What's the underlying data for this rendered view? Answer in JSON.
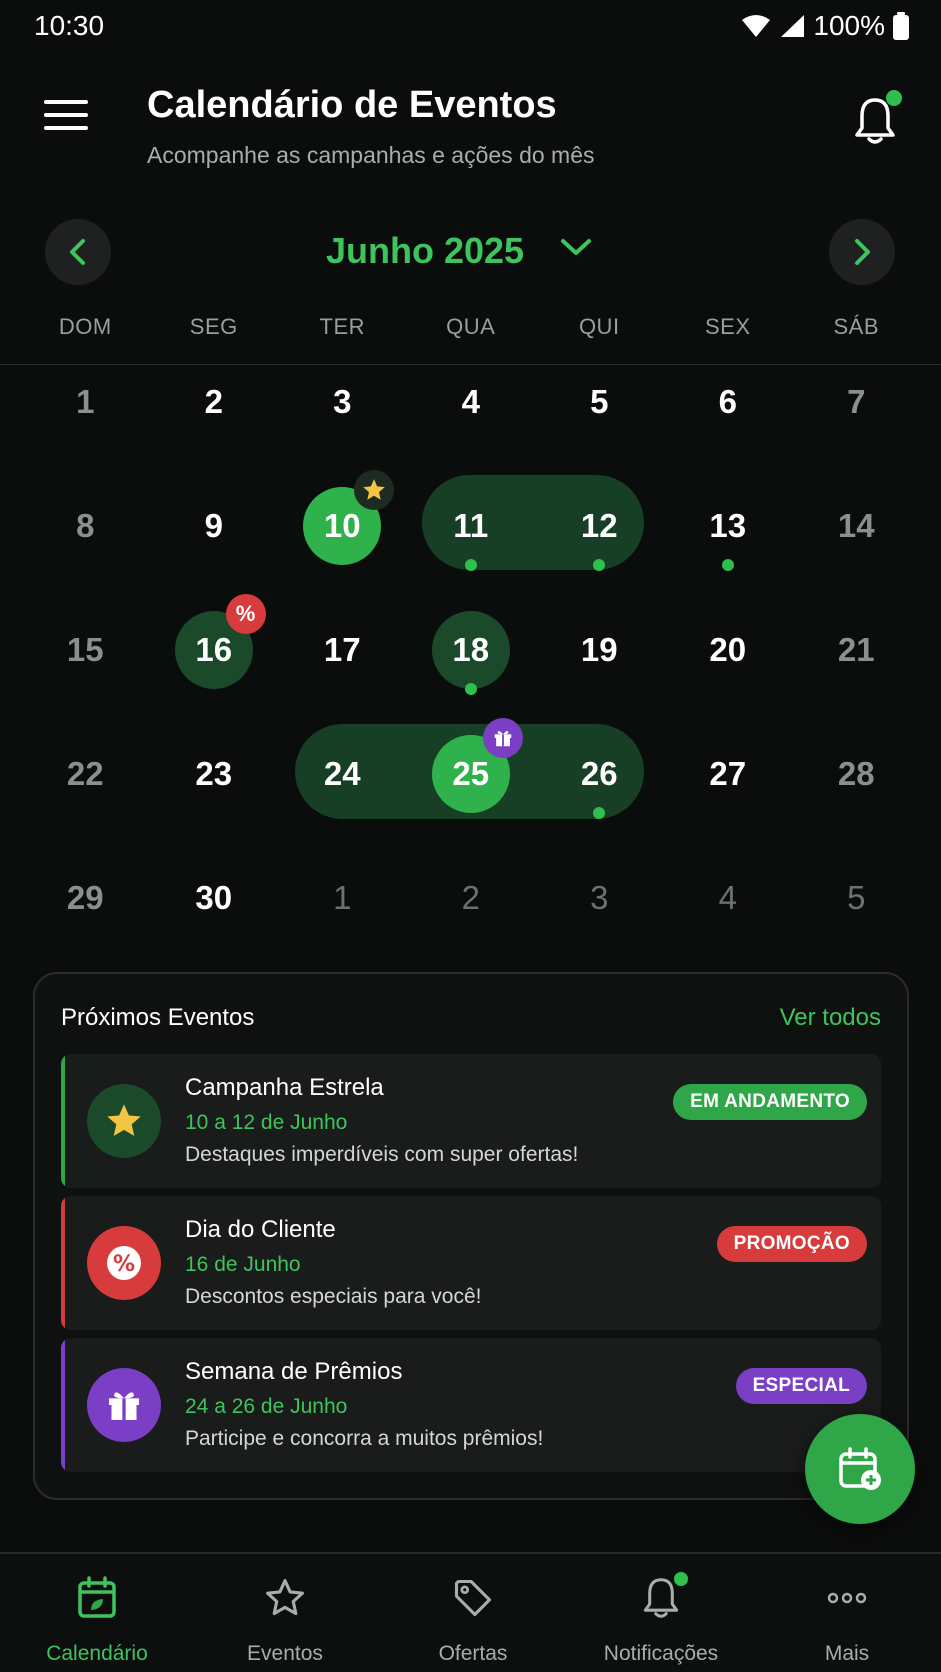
{
  "status": {
    "time": "10:30",
    "battery": "100%"
  },
  "header": {
    "title": "Calendário de Eventos",
    "subtitle": "Acompanhe as campanhas e ações do mês"
  },
  "calendar": {
    "month": "Junho 2025",
    "weekdays": [
      "DOM",
      "SEG",
      "TER",
      "QUA",
      "QUI",
      "SEX",
      "SÁB"
    ],
    "weeks": [
      [
        "1",
        "2",
        "3",
        "4",
        "5",
        "6",
        "7"
      ],
      [
        "8",
        "9",
        "10",
        "11",
        "12",
        "13",
        "14"
      ],
      [
        "15",
        "16",
        "17",
        "18",
        "19",
        "20",
        "21"
      ],
      [
        "22",
        "23",
        "24",
        "25",
        "26",
        "27",
        "28"
      ],
      [
        "29",
        "30",
        "1",
        "2",
        "3",
        "4",
        "5"
      ]
    ]
  },
  "events": {
    "title": "Próximos Eventos",
    "see_all": "Ver todos",
    "items": [
      {
        "name": "Campanha Estrela",
        "date": "10 a 12 de Junho",
        "description": "Destaques imperdíveis com super ofertas!",
        "tag": "EM ANDAMENTO",
        "icon": "star-icon",
        "color": "#2fa748"
      },
      {
        "name": "Dia do Cliente",
        "date": "16 de Junho",
        "description": "Descontos especiais para você!",
        "tag": "PROMOÇÃO",
        "icon": "percent-icon",
        "color": "#d83b3b"
      },
      {
        "name": "Semana de Prêmios",
        "date": "24 a 26 de Junho",
        "description": "Participe e concorra a muitos prêmios!",
        "tag": "ESPECIAL",
        "icon": "gift-icon",
        "color": "#7b3fc6"
      }
    ]
  },
  "bottom_nav": [
    {
      "label": "Calendário",
      "icon": "calendar-icon"
    },
    {
      "label": "Eventos",
      "icon": "star-outline-icon"
    },
    {
      "label": "Ofertas",
      "icon": "tag-icon"
    },
    {
      "label": "Notificações",
      "icon": "bell-icon"
    },
    {
      "label": "Mais",
      "icon": "more-icon"
    }
  ],
  "colors": {
    "accent": "#3ec45c",
    "background": "#0b0c0c",
    "promo": "#d83b3b",
    "special": "#7b3fc6"
  }
}
